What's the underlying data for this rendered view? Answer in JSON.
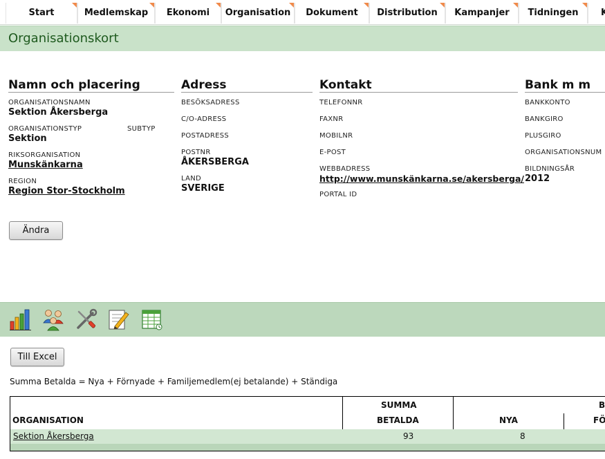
{
  "nav": {
    "tabs": [
      {
        "label": "Start"
      },
      {
        "label": "Medlemskap"
      },
      {
        "label": "Ekonomi"
      },
      {
        "label": "Organisation"
      },
      {
        "label": "Dokument"
      },
      {
        "label": "Distribution"
      },
      {
        "label": "Kampanjer"
      },
      {
        "label": "Tidningen"
      },
      {
        "label": "K"
      }
    ]
  },
  "page": {
    "title": "Organisationskort"
  },
  "namn": {
    "heading": "Namn och placering",
    "orgnamn_label": "ORGANISATIONSNAMN",
    "orgnamn_value": "Sektion Åkersberga",
    "orgtyp_label": "ORGANISATIONSTYP",
    "subtyp_label": "SUBTYP",
    "orgtyp_value": "Sektion",
    "riks_label": "RIKSORGANISATION",
    "riks_value": "Munskänkarna",
    "region_label": "REGION",
    "region_value": "Region Stor-Stockholm"
  },
  "adress": {
    "heading": "Adress",
    "besok_label": "BESÖKSADRESS",
    "co_label": "C/O-ADRESS",
    "post_label": "POSTADRESS",
    "postnr_label": "POSTNR",
    "postnr_value": "ÅKERSBERGA",
    "land_label": "LAND",
    "land_value": "SVERIGE"
  },
  "kontakt": {
    "heading": "Kontakt",
    "telefon_label": "TELEFONNR",
    "fax_label": "FAXNR",
    "mobil_label": "MOBILNR",
    "epost_label": "E-POST",
    "webb_label": "WEBBADRESS",
    "webb_value": "http://www.munskänkarna.se/akersberga/",
    "portal_label": "PORTAL ID"
  },
  "bank": {
    "heading": "Bank m m",
    "bankkonto_label": "BANKKONTO",
    "bankgiro_label": "BANKGIRO",
    "plusgiro_label": "PLUSGIRO",
    "orgnum_label": "ORGANISATIONSNUM",
    "bildning_label": "BILDNINGSÅR",
    "bildning_value": "2012"
  },
  "actions": {
    "edit_label": "Ändra",
    "excel_label": "Till Excel"
  },
  "toolbar": {
    "icons": [
      "bar-chart-icon",
      "users-icon",
      "tools-icon",
      "edit-pencil-icon",
      "spreadsheet-icon"
    ]
  },
  "formula": "Summa Betalda = Nya + Förnyade + Familjemedlem(ej betalande) + Ständiga",
  "table": {
    "col_org": "ORGANISATION",
    "col_summa_top": "SUMMA",
    "col_summa_bottom": "BETALDA",
    "col_nya": "NYA",
    "col_b_top": "B",
    "col_fo_bottom": "FÖ",
    "rows": [
      {
        "org": "Sektion Åkersberga",
        "summa": "93",
        "nya": "8"
      }
    ]
  }
}
